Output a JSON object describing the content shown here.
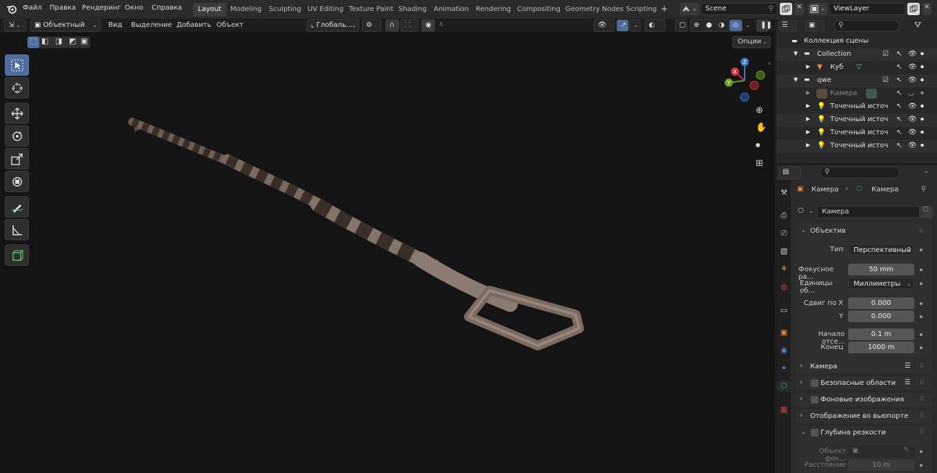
{
  "topbar": {
    "menus": [
      "Файл",
      "Правка",
      "Рендеринг",
      "Окно",
      "Справка"
    ],
    "workspaces": [
      "Layout",
      "Modeling",
      "Sculpting",
      "UV Editing",
      "Texture Paint",
      "Shading",
      "Animation",
      "Rendering",
      "Compositing",
      "Geometry Nodes",
      "Scripting"
    ],
    "add_tab": "+",
    "scene": "Scene",
    "view_layer": "ViewLayer"
  },
  "viewport_header": {
    "mode": "Объектный ре...",
    "menus": [
      "Вид",
      "Выделение",
      "Добавить",
      "Объект"
    ],
    "transform_orientation": "Глобаль...",
    "options": "Опции"
  },
  "gizmo": {
    "z": "Z",
    "y": "Y",
    "x": "X"
  },
  "outliner": {
    "search_placeholder": "",
    "scene_collection": "Коллекция сцены",
    "rows": [
      {
        "name": "Collection",
        "level": 1
      },
      {
        "name": "Куб",
        "level": 2
      },
      {
        "name": "qwe",
        "level": 1
      },
      {
        "name": "Камера",
        "level": 2
      },
      {
        "name": "Точечный источ",
        "level": 2
      },
      {
        "name": "Точечный источ",
        "level": 2
      },
      {
        "name": "Точечный источ",
        "level": 2
      },
      {
        "name": "Точечный источ",
        "level": 2
      }
    ]
  },
  "properties": {
    "breadcrumb_object": "Камера",
    "breadcrumb_data": "Камера",
    "datablock_name": "Камера",
    "lens_panel": "Объектив",
    "type_label": "Тип",
    "type_value": "Перспективный",
    "focal_label": "Фокусное ра...",
    "focal_value": "50 mm",
    "units_label": "Единицы об...",
    "units_value": "Миллиметры",
    "shift_x_label": "Сдвиг по X",
    "shift_x_value": "0.000",
    "shift_y_label": "Y",
    "shift_y_value": "0.000",
    "clip_start_label": "Начало отсе...",
    "clip_start_value": "0.1 m",
    "clip_end_label": "Конец",
    "clip_end_value": "1000 m",
    "panels": [
      "Камера",
      "Безопасные области",
      "Фоновые изображения",
      "Отображение во вьюпорте",
      "Глубина резкости"
    ],
    "focus_object_label": "Объект фок...",
    "distance_label": "Расстояние",
    "distance_value": "10 m"
  },
  "colors": {
    "accent": "#4e6c9e",
    "axis_x": "#d0343f",
    "axis_y": "#6aa323",
    "axis_z": "#3f78d1",
    "camera_tab": "#29b37a"
  }
}
